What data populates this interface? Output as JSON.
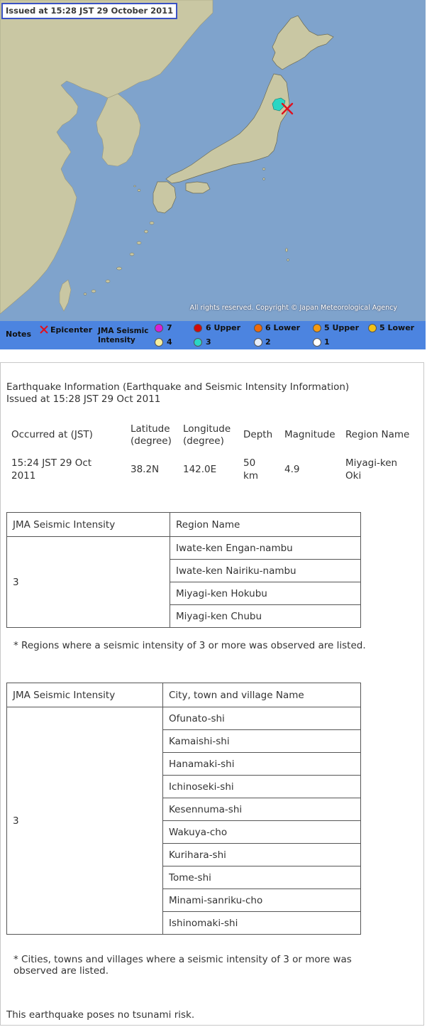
{
  "map": {
    "issued_banner": "Issued at 15:28 JST 29 October 2011",
    "copyright": "All rights reserved. Copyright © Japan Meteorological Agency",
    "colors": {
      "sea": "#7fa3cc",
      "land": "#c9c7a3",
      "mainland_border": "#6b6b55",
      "intensity_3": "#2ad6c4",
      "epicenter": "#e0101e"
    }
  },
  "legend": {
    "notes_label": "Notes",
    "epicenter_label": "Epicenter",
    "scale_label_line1": "JMA Seismic",
    "scale_label_line2": "Intensity",
    "items": [
      {
        "label": "7",
        "color": "#d81ed8"
      },
      {
        "label": "6 Upper",
        "color": "#d20a0a"
      },
      {
        "label": "6 Lower",
        "color": "#f06a0a"
      },
      {
        "label": "5 Upper",
        "color": "#f59a12"
      },
      {
        "label": "5 Lower",
        "color": "#f3c218"
      },
      {
        "label": "4",
        "color": "#f7ef9e"
      },
      {
        "label": "3",
        "color": "#2ad6c4"
      },
      {
        "label": "2",
        "color": "#e6eefa"
      },
      {
        "label": "1",
        "color": "#ffffff"
      }
    ]
  },
  "info": {
    "title": "Earthquake Information (Earthquake and Seismic Intensity Information)",
    "issued": "Issued at 15:28 JST 29 Oct 2011",
    "headers": {
      "occurred": "Occurred at (JST)",
      "latitude_1": "Latitude",
      "latitude_2": "(degree)",
      "longitude_1": "Longitude",
      "longitude_2": "(degree)",
      "depth": "Depth",
      "magnitude": "Magnitude",
      "region": "Region Name"
    },
    "values": {
      "occurred_1": "15:24 JST 29 Oct",
      "occurred_2": "2011",
      "latitude": "38.2N",
      "longitude": "142.0E",
      "depth_1": "50",
      "depth_2": "km",
      "magnitude": "4.9",
      "region_1": "Miyagi-ken",
      "region_2": "Oki"
    }
  },
  "regions_table": {
    "col1": "JMA Seismic Intensity",
    "col2": "Region Name",
    "intensity": "3",
    "rows": [
      "Iwate-ken Engan-nambu",
      "Iwate-ken Nairiku-nambu",
      "Miyagi-ken Hokubu",
      "Miyagi-ken Chubu"
    ],
    "note": "* Regions where a seismic intensity of 3 or more was observed are listed."
  },
  "cities_table": {
    "col1": "JMA Seismic Intensity",
    "col2": "City, town and village Name",
    "intensity": "3",
    "rows": [
      "Ofunato-shi",
      "Kamaishi-shi",
      "Hanamaki-shi",
      "Ichinoseki-shi",
      "Kesennuma-shi",
      "Wakuya-cho",
      "Kurihara-shi",
      "Tome-shi",
      "Minami-sanriku-cho",
      "Ishinomaki-shi"
    ],
    "note_1": "* Cities, towns and villages where a seismic intensity of 3 or more was",
    "note_2": "observed are listed."
  },
  "tsunami": "This earthquake poses no tsunami risk."
}
